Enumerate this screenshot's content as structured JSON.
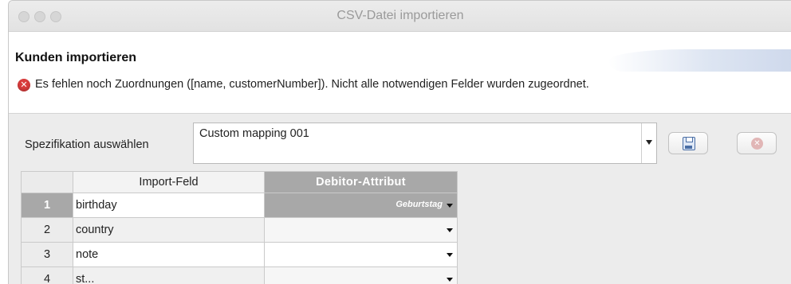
{
  "window": {
    "title": "CSV-Datei importieren"
  },
  "header": {
    "heading": "Kunden importieren",
    "error_icon": "error-icon",
    "error_message": "Es fehlen noch Zuordnungen ([name, customerNumber]). Nicht alle notwendigen Felder wurden zugeordnet."
  },
  "spec": {
    "label": "Spezifikation auswählen",
    "selected": "Custom mapping 001",
    "save_icon": "save-icon",
    "delete_icon": "delete-icon"
  },
  "table": {
    "columns": [
      "",
      "Import-Feld",
      "Debitor-Attribut"
    ],
    "rows": [
      {
        "num": "1",
        "field": "birthday",
        "attribute": "Geburtstag",
        "selected": true
      },
      {
        "num": "2",
        "field": "country",
        "attribute": "",
        "selected": false
      },
      {
        "num": "3",
        "field": "note",
        "attribute": "",
        "selected": false
      },
      {
        "num": "4",
        "field": "st...",
        "attribute": "",
        "selected": false
      }
    ]
  }
}
